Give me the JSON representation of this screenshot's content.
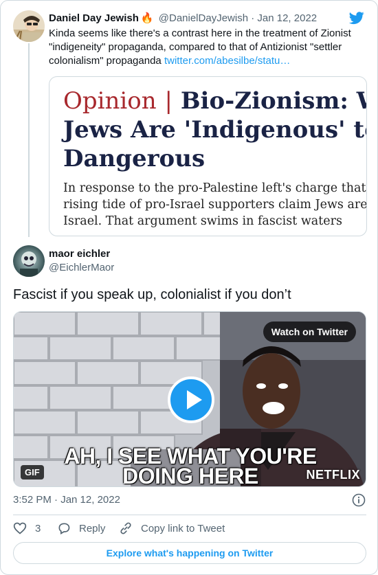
{
  "quoted_tweet": {
    "author_name": "Daniel Day Jewish",
    "emoji": "🔥",
    "handle": "@DanielDayJewish",
    "separator": "·",
    "date": "Jan 12, 2022",
    "text": "Kinda seems like there's a contrast here in the treatment of Zionist \"indigeneity\" propaganda, compared to that of Antizionist \"settler colonialism\" propaganda ",
    "link": "twitter.com/abesilbe/statu…",
    "article_card": {
      "label": "Opinion",
      "bar": "|",
      "headline_line1": "Bio-Zionism: W",
      "headline_line2": "Jews Are 'Indigenous' to I",
      "headline_line3": "Dangerous",
      "sub_line1": "In response to the pro-Palestine left's charge that Z",
      "sub_line2": "rising tide of pro-Israel supporters claim Jews are g",
      "sub_line3": "Israel. That argument swims in fascist waters"
    }
  },
  "main_tweet": {
    "author_name": "maor eichler",
    "handle": "@EichlerMaor",
    "text": "Fascist if you speak up, colonialist if you don’t",
    "media": {
      "watch_label": "Watch on Twitter",
      "caption_line1": "AH, I SEE WHAT YOU'RE",
      "caption_line2": "DOING HERE",
      "gif_badge": "GIF",
      "brand_watermark": "NETFLIX"
    },
    "timestamp": "3:52 PM · Jan 12, 2022"
  },
  "actions": {
    "like_count": "3",
    "reply_label": "Reply",
    "copy_label": "Copy link to Tweet"
  },
  "explore_label": "Explore what's happening on Twitter",
  "colors": {
    "accent": "#1d9bf0",
    "muted_text": "#536471",
    "border": "#cfd9de",
    "opinion_red": "#a8282d",
    "headline_navy": "#1a2345"
  },
  "icons": [
    "twitter-bird-icon",
    "info-icon",
    "heart-icon",
    "reply-icon",
    "link-icon",
    "play-icon"
  ]
}
